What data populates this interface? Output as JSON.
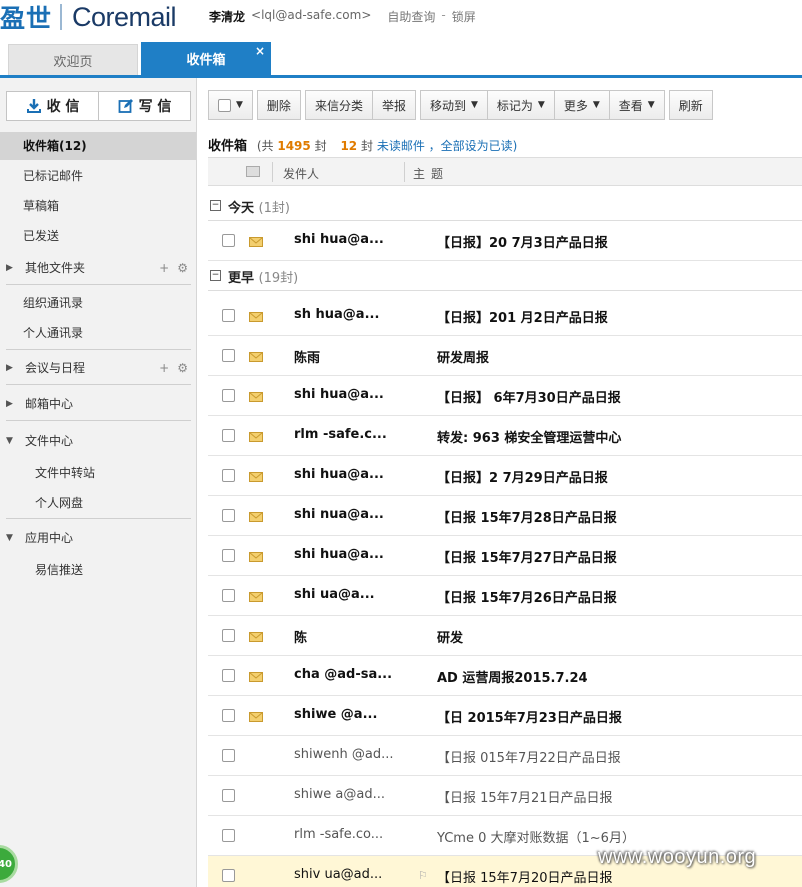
{
  "header": {
    "logo_cn": "盈世",
    "logo_en": "Coremail",
    "user_name": "李清龙",
    "user_email": "<lql@ad-safe.com>",
    "self_service": "自助查询",
    "dash": "-",
    "lock": "锁屏"
  },
  "tabs": [
    {
      "label": "欢迎页"
    },
    {
      "label": "收件箱",
      "close": "×"
    }
  ],
  "sidebar": {
    "receive": "收 信",
    "write": "写 信",
    "items": [
      {
        "label": "收件箱(12)"
      },
      {
        "label": "已标记邮件"
      },
      {
        "label": "草稿箱"
      },
      {
        "label": "已发送"
      },
      {
        "label": "其他文件夹"
      },
      {
        "label": "组织通讯录"
      },
      {
        "label": "个人通讯录"
      },
      {
        "label": "会议与日程"
      },
      {
        "label": "邮箱中心"
      },
      {
        "label": "文件中心"
      },
      {
        "label": "文件中转站"
      },
      {
        "label": "个人网盘"
      },
      {
        "label": "应用中心"
      },
      {
        "label": "易信推送"
      }
    ],
    "plus": "+",
    "gear": "⚙"
  },
  "toolbar": {
    "delete": "删除",
    "classify": "来信分类",
    "report": "举报",
    "move": "移动到",
    "mark": "标记为",
    "more": "更多",
    "view": "查看",
    "refresh": "刷新"
  },
  "summary": {
    "title": "收件箱",
    "total_prefix": "(共",
    "total": "1495",
    "total_suffix": "封",
    "unread": "12",
    "unread_suffix": "封",
    "unread_link": "未读邮件",
    "mark_all": "，全部设为已读)"
  },
  "table": {
    "col_sender": "发件人",
    "col_subject": "主题"
  },
  "sections": [
    {
      "label": "今天",
      "count": "(1封)"
    },
    {
      "label": "更早",
      "count": "(19封)"
    }
  ],
  "messages": [
    {
      "sender": "shi     hua@a...",
      "subject": "【日报】20    7月3日产品日报",
      "state": "unread"
    },
    {
      "sender": "sh     hua@a...",
      "subject": "【日报】201    月2日产品日报",
      "state": "unread"
    },
    {
      "sender": "陈雨",
      "subject": "研发周报",
      "state": "unread"
    },
    {
      "sender": "shi     hua@a...",
      "subject": "【日报】    6年7月30日产品日报",
      "state": "unread"
    },
    {
      "sender": "rlm     -safe.c...",
      "subject": "转发: 963     梯安全管理运营中心",
      "state": "unread"
    },
    {
      "sender": "shi     hua@a...",
      "subject": "【日报】2     7月29日产品日报",
      "state": "unread"
    },
    {
      "sender": "shi     nua@a...",
      "subject": "【日报     15年7月28日产品日报",
      "state": "unread"
    },
    {
      "sender": "shi     hua@a...",
      "subject": "【日报     15年7月27日产品日报",
      "state": "unread"
    },
    {
      "sender": "shi     ua@a...",
      "subject": "【日报     15年7月26日产品日报",
      "state": "unread"
    },
    {
      "sender": "陈",
      "subject": "研发",
      "state": "unread"
    },
    {
      "sender": "cha     @ad-sa...",
      "subject": "AD     运营周报2015.7.24",
      "state": "unread"
    },
    {
      "sender": "shiwe     @a...",
      "subject": "【日     2015年7月23日产品日报",
      "state": "unread"
    },
    {
      "sender": "shiwenh     @ad...",
      "subject": "【日报     015年7月22日产品日报",
      "state": "read"
    },
    {
      "sender": "shiwe     a@ad...",
      "subject": "【日报     15年7月21日产品日报",
      "state": "read"
    },
    {
      "sender": "rlm     -safe.co...",
      "subject": "YCme     0 大摩对账数据（1~6月）",
      "state": "read"
    },
    {
      "sender": "shiv     ua@ad...",
      "subject": "【日报     15年7月20日产品日报",
      "state": "selected"
    }
  ],
  "badge": "40",
  "watermark": "www.wooyun.org",
  "colors": {
    "accent": "#1f7fc6",
    "count_orange": "#e07b00",
    "link_blue": "#1a6fb5",
    "envelope": "#e8b84a"
  }
}
